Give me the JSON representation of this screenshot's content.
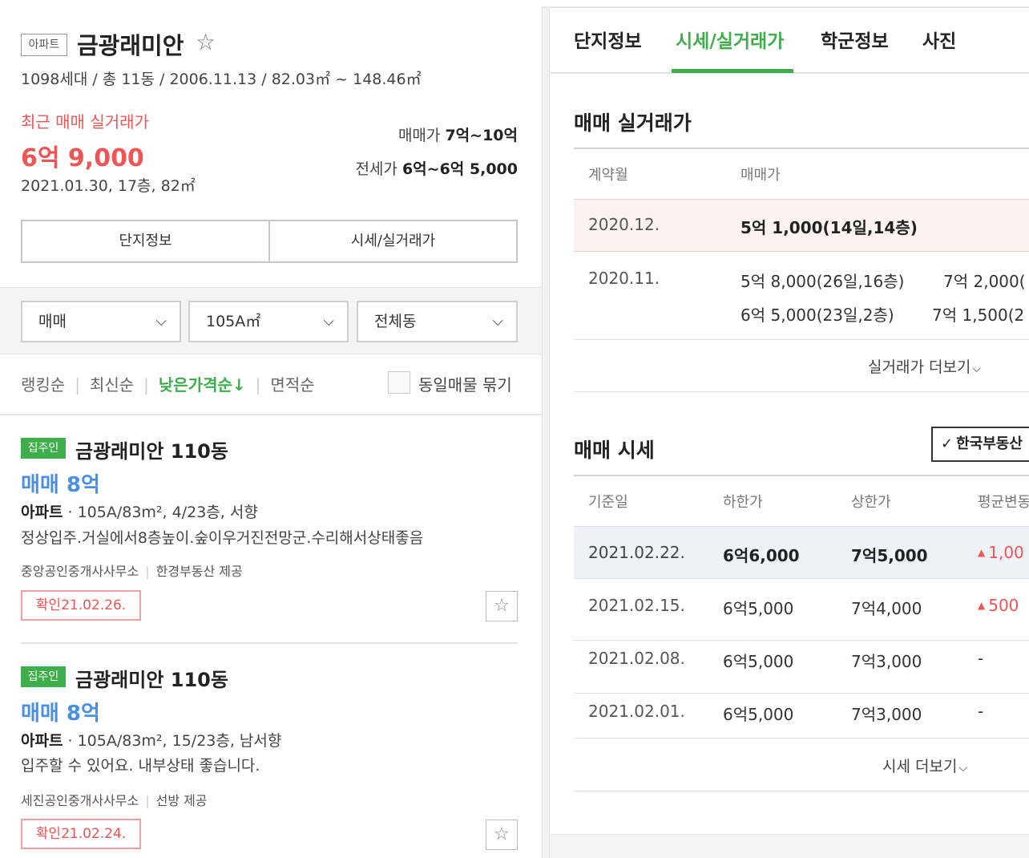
{
  "listing": {
    "type_badge": "아파트",
    "name": "금광래미안",
    "summary": "1098세대 / 총 11동 / 2006.11.13 / 82.03㎡ ~ 148.46㎡",
    "recent_label": "최근 매매 실거래가",
    "recent_price": "6억 9,000",
    "recent_detail": "2021.01.30, 17층, 82㎡",
    "sale_label": "매매가",
    "sale_range": "7억~10억",
    "jeonse_label": "전세가",
    "jeonse_range": "6억~6억 5,000",
    "btn_info": "단지정보",
    "btn_price": "시세/실거래가"
  },
  "filters": {
    "trade": "매매",
    "area": "105A㎡",
    "dong": "전체동"
  },
  "sort": {
    "items": [
      "랭킹순",
      "최신순",
      "낮은가격순↓",
      "면적순"
    ],
    "group_label": "동일매물 묶기"
  },
  "cards": [
    {
      "badge": "집주인",
      "title": "금광래미안 110동",
      "price": "매매 8억",
      "spec_type": "아파트",
      "spec": " · 105A/83m², 4/23층, 서향",
      "desc": "정상입주.거실에서8층높이.숲이우거진전망군.수리해서상태좋음",
      "agency": "중앙공인중개사사무소",
      "provider": "한경부동산 제공",
      "confirm": "확인21.02.26."
    },
    {
      "badge": "집주인",
      "title": "금광래미안 110동",
      "price": "매매 8억",
      "spec_type": "아파트",
      "spec": " · 105A/83m², 15/23층, 남서향",
      "desc": "입주할 수 있어요. 내부상태 좋습니다.",
      "agency": "세진공인중개사사무소",
      "provider": "선방 제공",
      "confirm": "확인21.02.24."
    }
  ],
  "tabs": [
    "단지정보",
    "시세/실거래가",
    "학군정보",
    "사진"
  ],
  "deals": {
    "title": "매매 실거래가",
    "col_month": "계약월",
    "col_price": "매매가",
    "rows": [
      {
        "month": "2020.12.",
        "a": "5억 1,000(14일,14층)",
        "b": ""
      },
      {
        "month": "2020.11.",
        "a": "5억 8,000(26일,16층)",
        "b": "7억 2,000(",
        "a2": "6억 5,000(23일,2층)",
        "b2": "7억 1,500(2"
      }
    ],
    "more": "실거래가 더보기"
  },
  "quotes": {
    "title": "매매 시세",
    "source_button": "한국부동산",
    "cols": [
      "기준일",
      "하한가",
      "상한가",
      "평균변동"
    ],
    "rows": [
      {
        "date": "2021.02.22.",
        "low": "6억6,000",
        "high": "7억5,000",
        "change": "1,00",
        "up": true
      },
      {
        "date": "2021.02.15.",
        "low": "6억5,000",
        "high": "7억4,000",
        "change": "500",
        "up": true
      },
      {
        "date": "2021.02.08.",
        "low": "6억5,000",
        "high": "7억3,000",
        "change": "-",
        "up": false
      },
      {
        "date": "2021.02.01.",
        "low": "6억5,000",
        "high": "7억3,000",
        "change": "-",
        "up": false
      }
    ],
    "more": "시세 더보기"
  },
  "colors": {
    "accent_green": "#3dae4a",
    "price_red": "#e55555",
    "price_blue": "#4a90e2"
  }
}
